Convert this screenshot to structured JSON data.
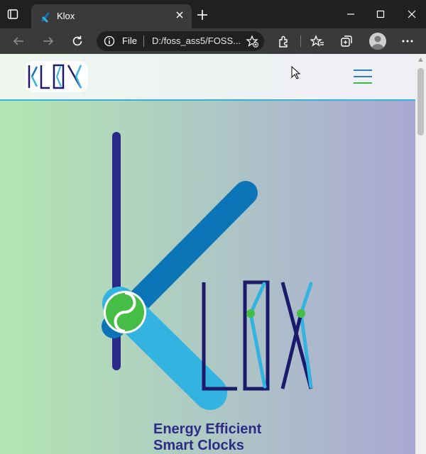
{
  "browser": {
    "tab_title": "Klox",
    "address_scheme_label": "File",
    "address_url": "D:/foss_ass5/FOSS...",
    "icons": [
      "window-menu-icon",
      "klox-favicon-icon",
      "close-icon",
      "plus-icon",
      "back-icon",
      "forward-icon",
      "refresh-icon",
      "info-icon",
      "star-add-icon",
      "extensions-icon",
      "favorites-icon",
      "collections-icon",
      "profile-icon",
      "more-icon",
      "minimize-icon",
      "maximize-icon",
      "window-close-icon"
    ]
  },
  "site": {
    "logo_text": "KL0X",
    "hero_wordmark": "L0X",
    "tagline_line1": "Energy Efficient",
    "tagline_line2": "Smart Clocks",
    "colors": {
      "navy": "#1c1a6b",
      "blue": "#0b75b8",
      "light_blue": "#33b4e0",
      "green": "#46bd45",
      "hamburger_blue": "#2a7fc5",
      "hamburger_green": "#3cba46",
      "gradient_left": "#b2e6b1",
      "gradient_right": "#aaa7d3"
    }
  }
}
